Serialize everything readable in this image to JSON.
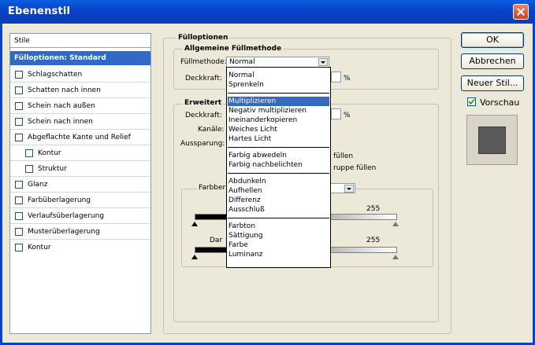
{
  "window": {
    "title": "Ebenenstil"
  },
  "sidebar": {
    "header": "Stile",
    "selected": "Fülloptionen: Standard",
    "items": [
      {
        "label": "Schlagschatten",
        "checked": false
      },
      {
        "label": "Schatten nach innen",
        "checked": false
      },
      {
        "label": "Schein nach außen",
        "checked": false
      },
      {
        "label": "Schein nach innen",
        "checked": false
      },
      {
        "label": "Abgeflachte Kante und Relief",
        "checked": false
      },
      {
        "label": "Kontur",
        "checked": false
      },
      {
        "label": "Struktur",
        "checked": false
      },
      {
        "label": "Glanz",
        "checked": false
      },
      {
        "label": "Farbüberlagerung",
        "checked": false
      },
      {
        "label": "Verlaufsüberlagerung",
        "checked": false
      },
      {
        "label": "Musterüberlagerung",
        "checked": false
      },
      {
        "label": "Kontur",
        "checked": false
      }
    ]
  },
  "main": {
    "group_title": "Fülloptionen",
    "general": {
      "title": "Allgemeine Füllmethode",
      "blend_label": "Füllmethode:",
      "blend_value": "Normal",
      "opacity_label": "Deckkraft:",
      "opacity_unit": "%"
    },
    "advanced": {
      "title": "Erweitert",
      "opacity_label": "Deckkraft:",
      "opacity_unit": "%",
      "channels_label": "Kanäle:",
      "knockout_label": "Aussparung:",
      "opt1_suffix": "füllen",
      "opt2_suffix": "ruppe füllen"
    },
    "blend_if": {
      "label": "Farbber",
      "this_layer_max": "255",
      "under_label": "Dar",
      "under_max": "255"
    }
  },
  "dropdown": {
    "groups": [
      [
        "Normal",
        "Sprenkeln"
      ],
      [
        "Multiplizieren",
        "Negativ multiplizieren",
        "Ineinanderkopieren",
        "Weiches Licht",
        "Hartes Licht"
      ],
      [
        "Farbig abwedeln",
        "Farbig nachbelichten"
      ],
      [
        "Abdunkeln",
        "Aufhellen",
        "Differenz",
        "Ausschluß"
      ],
      [
        "Farbton",
        "Sättigung",
        "Farbe",
        "Luminanz"
      ]
    ],
    "highlighted": "Multiplizieren"
  },
  "buttons": {
    "ok": "OK",
    "cancel": "Abbrechen",
    "new_style": "Neuer Stil..."
  },
  "preview": {
    "label": "Vorschau",
    "checked": true
  },
  "colors": {
    "title_bar": "#0842c8",
    "selection": "#316ac5",
    "dialog_bg": "#ece9d8"
  }
}
